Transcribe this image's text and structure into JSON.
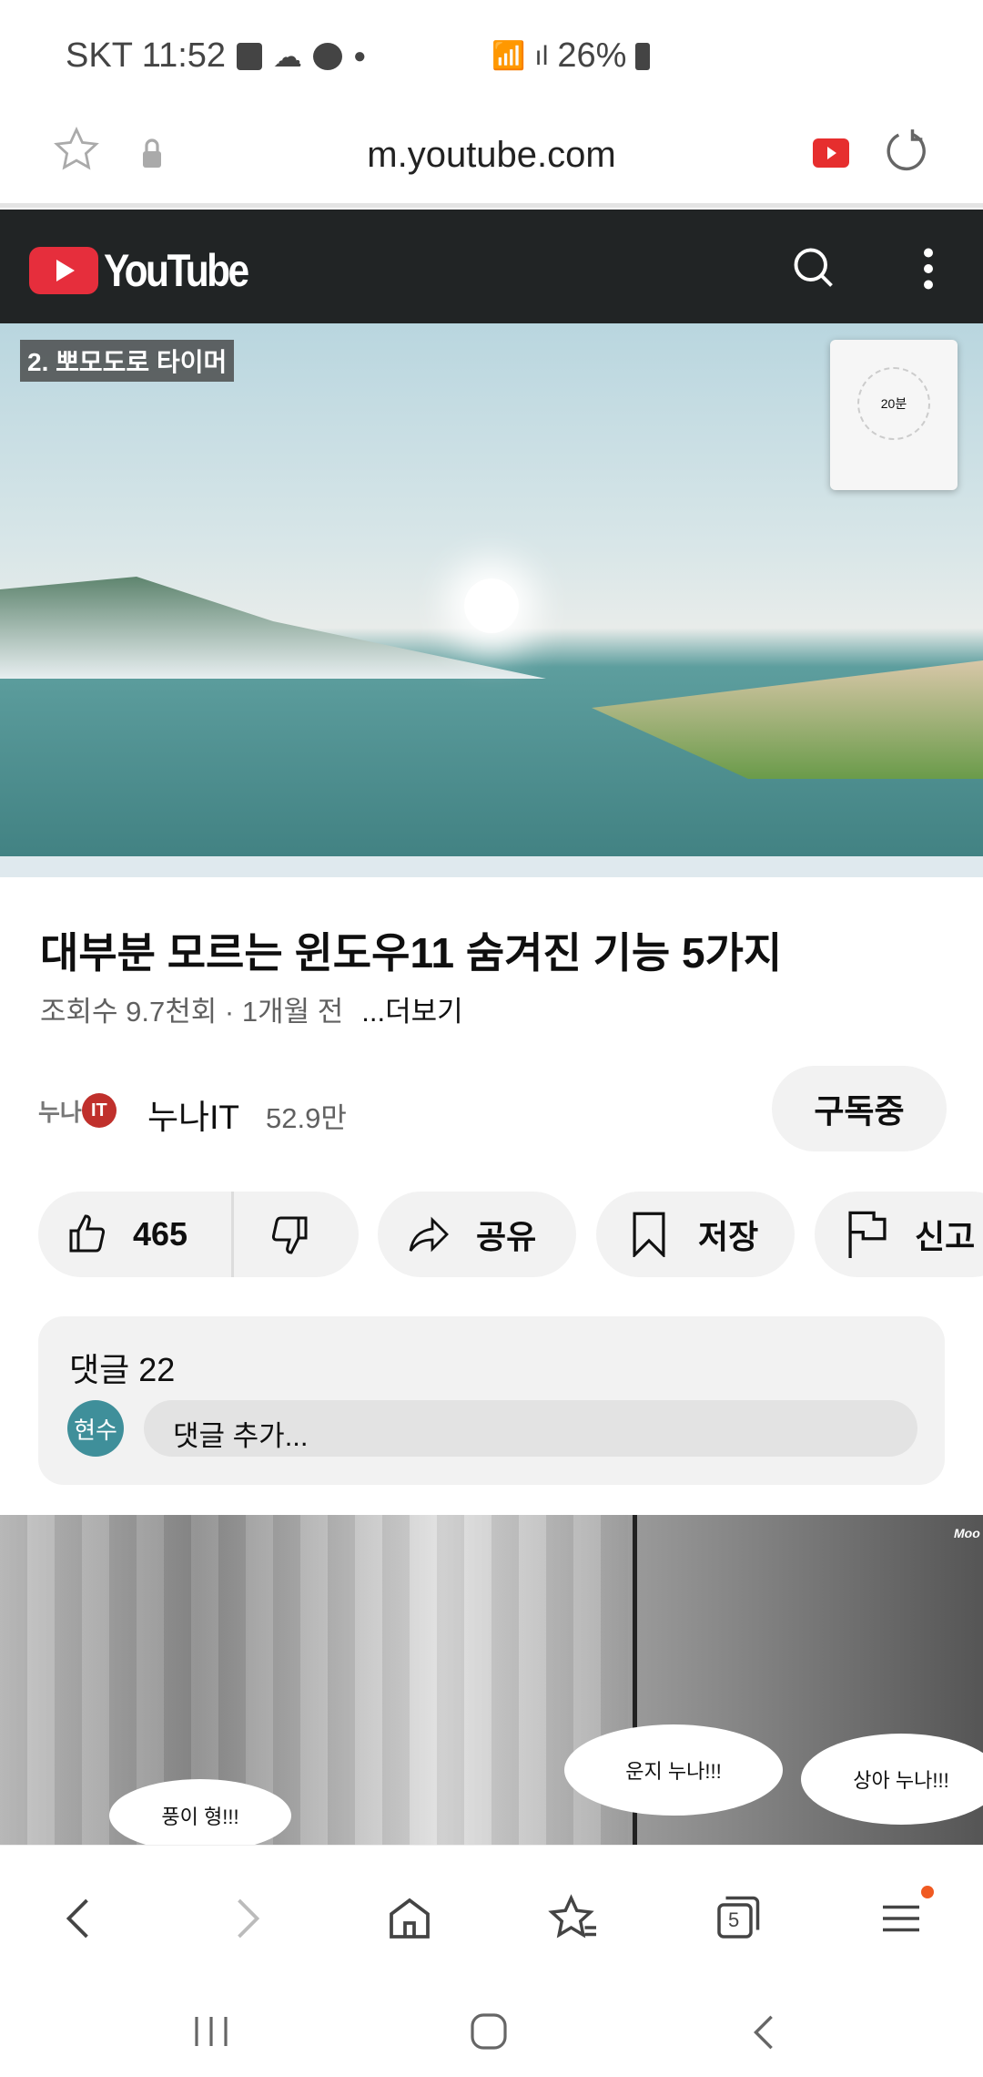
{
  "status": {
    "carrier_time": "SKT 11:52",
    "battery": "26%",
    "icons": [
      "gallery-icon",
      "cloud-icon",
      "planet-icon",
      "dot-icon",
      "wifi-icon",
      "signal-icon",
      "battery-charging-icon"
    ]
  },
  "browser": {
    "url": "m.youtube.com",
    "tab_count": "5"
  },
  "youtube": {
    "logo_text": "YouTube",
    "brand_color": "#e62e3c"
  },
  "video": {
    "overlay_text": "2. 뽀모도로 타이머",
    "timer_value": "20분"
  },
  "info": {
    "title": "대부분 모르는 윈도우11 숨겨진 기능 5가지",
    "meta": "조회수 9.7천회 · 1개월 전",
    "more": "...더보기"
  },
  "channel": {
    "logo_text": "누나IT",
    "name": "누나IT",
    "subs": "52.9만",
    "subscribe_label": "구독중"
  },
  "actions": {
    "likes": "465",
    "share": "공유",
    "save": "저장",
    "report": "신고"
  },
  "comments": {
    "header": "댓글 22",
    "avatar_text": "현수",
    "avatar_color": "#3f8f9a",
    "placeholder": "댓글 추가..."
  },
  "ad": {
    "bubbles": [
      "풍이 형!!!",
      "운지 누나!!!",
      "상아 누나!!!"
    ],
    "corner": "Moo"
  }
}
